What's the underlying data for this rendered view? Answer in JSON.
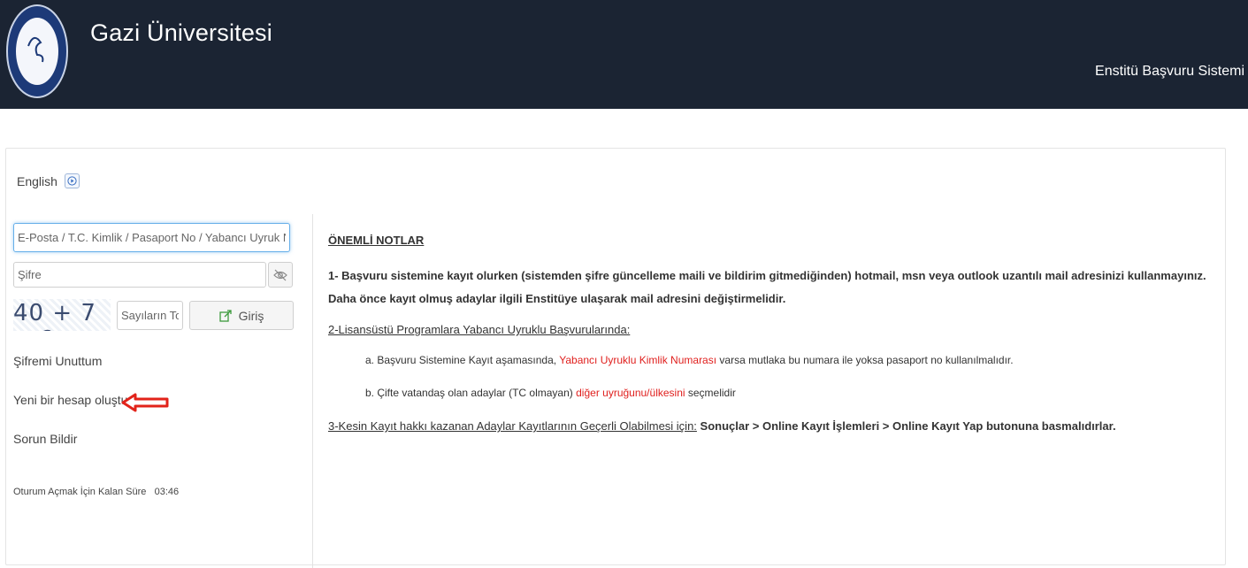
{
  "header": {
    "brand": "Gazi Üniversitesi",
    "system_name": "Enstitü Başvuru Sistemi",
    "logo_text": "GAZİ ÜNİVERSİTESİ 1926"
  },
  "language_switch": {
    "label": "English"
  },
  "login": {
    "username_placeholder": "E-Posta / T.C. Kimlik / Pasaport No / Yabancı Uyruk No",
    "password_placeholder": "Şifre",
    "captcha_text": "40 + 7 = ?",
    "captcha_placeholder": "Sayıların Toplamı",
    "login_label": "Giriş"
  },
  "links": {
    "forgot_password": "Şifremi Unuttum",
    "create_account": "Yeni bir hesap oluştur",
    "report_problem": "Sorun Bildir"
  },
  "session": {
    "label": "Oturum Açmak İçin Kalan Süre",
    "time": "03:46"
  },
  "notes": {
    "title": "ÖNEMLİ NOTLAR",
    "item1": "1- Başvuru sistemine kayıt olurken (sistemden şifre güncelleme maili ve bildirim gitmediğinden) hotmail, msn veya outlook uzantılı mail adresinizi kullanmayınız. Daha önce kayıt olmuş adaylar ilgili Enstitüye ulaşarak mail adresini değiştirmelidir.",
    "item2_title": "2-Lisansüstü Programlara Yabancı Uyruklu Başvurularında:",
    "item2a_pre": "a. Başvuru Sistemine Kayıt aşamasında, ",
    "item2a_red": "Yabancı Uyruklu Kimlik Numarası",
    "item2a_post": " varsa mutlaka bu numara ile yoksa pasaport no kullanılmalıdır.",
    "item2b_pre": "b. Çifte vatandaş olan adaylar (TC olmayan) ",
    "item2b_red": "diğer uyruğunu/ülkesini",
    "item2b_post": " seçmelidir",
    "item3_pre": "3-Kesin Kayıt hakkı kazanan Adaylar Kayıtlarının Geçerli Olabilmesi için:",
    "item3_bold": " Sonuçlar > Online Kayıt İşlemleri > Online Kayıt Yap butonuna basmalıdırlar."
  },
  "colors": {
    "header_bg": "#1b2433",
    "highlight_red": "#e0201e",
    "arrow_red": "#e2231a"
  }
}
